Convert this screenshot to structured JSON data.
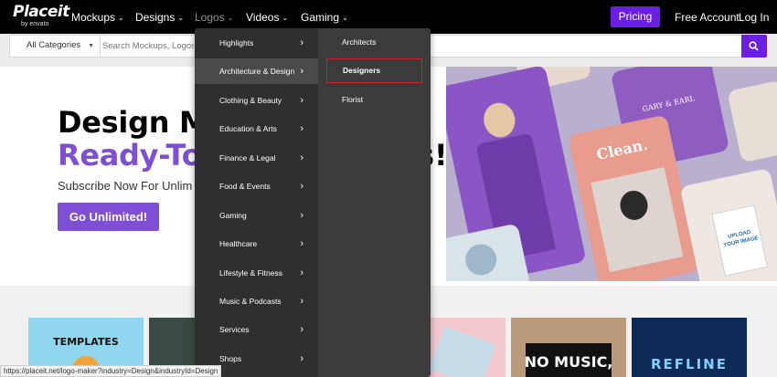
{
  "nav": {
    "logo_main": "Placeit",
    "logo_sub": "by envato",
    "items": [
      {
        "label": "Mockups"
      },
      {
        "label": "Designs"
      },
      {
        "label": "Logos"
      },
      {
        "label": "Videos"
      },
      {
        "label": "Gaming"
      }
    ],
    "pricing_label": "Pricing",
    "free_account_label": "Free Account",
    "login_label": "Log In",
    "accent_color": "#6b1ee4"
  },
  "search": {
    "category_value": "All Categories",
    "placeholder": "Search Mockups, Logos",
    "icon": "search-icon"
  },
  "hero": {
    "title_line1": "Design Mo",
    "title_line2": "Ready-To",
    "title_line2_end": "s!",
    "subtitle": "Subscribe Now For Unlim",
    "cta_label": "Go Unlimited!",
    "accent_color": "#7e4fd4"
  },
  "hero_art_text": {
    "card_names": "GARY & EARL",
    "card_clean": "Clean.",
    "shirt_text": "UPLOAD YOUR IMAGE"
  },
  "templates_row": {
    "tile1": "TEMPLATES",
    "tile2": "NO MUSIC,",
    "tile3": "REFLINE"
  },
  "dropdown": {
    "categories": [
      {
        "label": "Highlights"
      },
      {
        "label": "Architecture & Design"
      },
      {
        "label": "Clothing & Beauty"
      },
      {
        "label": "Education & Arts"
      },
      {
        "label": "Finance & Legal"
      },
      {
        "label": "Food & Events"
      },
      {
        "label": "Gaming"
      },
      {
        "label": "Healthcare"
      },
      {
        "label": "Lifestyle & Fitness"
      },
      {
        "label": "Music & Podcasts"
      },
      {
        "label": "Services"
      },
      {
        "label": "Shops"
      }
    ],
    "active_category": "Architecture & Design",
    "subcategories": [
      {
        "label": "Architects"
      },
      {
        "label": "Designers"
      },
      {
        "label": "Florist"
      }
    ],
    "selected_subcategory": "Designers",
    "highlight_color": "#d51f2a"
  },
  "status_bar": {
    "url": "https://placeit.net/logo-maker?industry=Design&industryId=Design"
  }
}
